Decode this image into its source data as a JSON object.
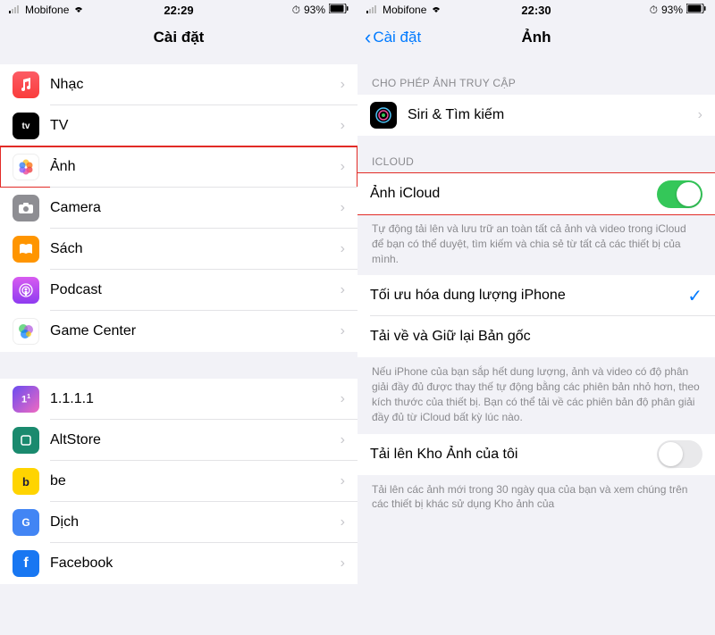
{
  "status": {
    "carrier": "Mobifone",
    "time_left": "22:29",
    "time_right": "22:30",
    "battery": "93%"
  },
  "left": {
    "title": "Cài đặt",
    "items1": [
      {
        "label": "Nhạc"
      },
      {
        "label": "TV"
      },
      {
        "label": "Ảnh"
      },
      {
        "label": "Camera"
      },
      {
        "label": "Sách"
      },
      {
        "label": "Podcast"
      },
      {
        "label": "Game Center"
      }
    ],
    "items2": [
      {
        "label": "1.1.1.1"
      },
      {
        "label": "AltStore"
      },
      {
        "label": "be"
      },
      {
        "label": "Dịch"
      },
      {
        "label": "Facebook"
      }
    ]
  },
  "right": {
    "back": "Cài đặt",
    "title": "Ảnh",
    "section1_header": "CHO PHÉP ẢNH TRUY CẬP",
    "siri": "Siri & Tìm kiếm",
    "section2_header": "ICLOUD",
    "icloud_photos": "Ảnh iCloud",
    "icloud_footer": "Tự động tải lên và lưu trữ an toàn tất cả ảnh và video trong iCloud để bạn có thể duyệt, tìm kiếm và chia sẻ từ tất cả các thiết bị của mình.",
    "optimize": "Tối ưu hóa dung lượng iPhone",
    "download": "Tải về và Giữ lại Bản gốc",
    "storage_footer": "Nếu iPhone của bạn sắp hết dung lượng, ảnh và video có độ phân giải đầy đủ được thay thế tự động bằng các phiên bản nhỏ hơn, theo kích thước của thiết bị. Bạn có thể tải về các phiên bản độ phân giải đầy đủ từ iCloud bất kỳ lúc nào.",
    "upload_stream": "Tải lên Kho Ảnh của tôi",
    "stream_footer": "Tải lên các ảnh mới trong 30 ngày qua của bạn và xem chúng trên các thiết bị khác sử dụng Kho ảnh của"
  }
}
